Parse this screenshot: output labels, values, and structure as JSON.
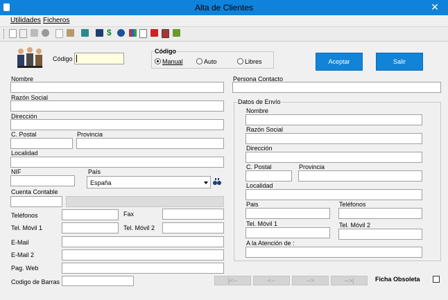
{
  "window": {
    "title": "Alta de Clientes",
    "close_glyph": "✕"
  },
  "menu": {
    "utilidades": "Utilidades",
    "ficheros": "Ficheros"
  },
  "toolbar_icons": [
    "new-doc-icon",
    "edit-doc-icon",
    "print-icon",
    "binoculars-icon",
    "copy-icon",
    "paste-icon",
    "exit-icon",
    "books-icon",
    "dollar-icon",
    "money-bag-icon",
    "chart-icon",
    "help-icon",
    "red-book-icon",
    "cards-icon",
    "green-book-icon"
  ],
  "form": {
    "codigo_label": "Código",
    "codigo_value": "",
    "codigo_group_title": "Código",
    "radio_manual": "Manual",
    "radio_auto": "Auto",
    "radio_libres": "Libres",
    "selected_mode": "Manual",
    "aceptar": "Aceptar",
    "salir": "Salir",
    "nombre": "Nombre",
    "persona_contacto": "Persona Contacto",
    "razon_social": "Razón Social",
    "direccion": "Dirección",
    "c_postal": "C. Postal",
    "provincia": "Provincia",
    "localidad": "Localidad",
    "nif": "NIF",
    "pais": "País",
    "pais_value": "España",
    "cuenta_contable": "Cuenta Contable",
    "telefonos": "Teléfonos",
    "fax": "Fax",
    "tel_movil_1": "Tel. Móvil 1",
    "tel_movil_2": "Tel. Móvil 2",
    "email": "E-Mail",
    "email_2": "E-Mail 2",
    "pag_web": "Pag. Web",
    "codigo_barras": "Codigo de Barras"
  },
  "envio": {
    "title": "Datos de Envío",
    "nombre": "Nombre",
    "razon_social": "Razón Social",
    "direccion": "Dirección",
    "c_postal": "C. Postal",
    "provincia": "Provincia",
    "localidad": "Localidad",
    "pais": "Pais",
    "telefonos": "Teléfonos",
    "tel_movil_1": "Tel. Móvil 1",
    "tel_movil_2": "Tel. Móvil 2",
    "atencion": "A la Atención de :"
  },
  "nav": {
    "first": "|<--",
    "prev": "<--",
    "next": "-->",
    "last": "-->|"
  },
  "ficha_obsoleta": "Ficha Obsoleta"
}
